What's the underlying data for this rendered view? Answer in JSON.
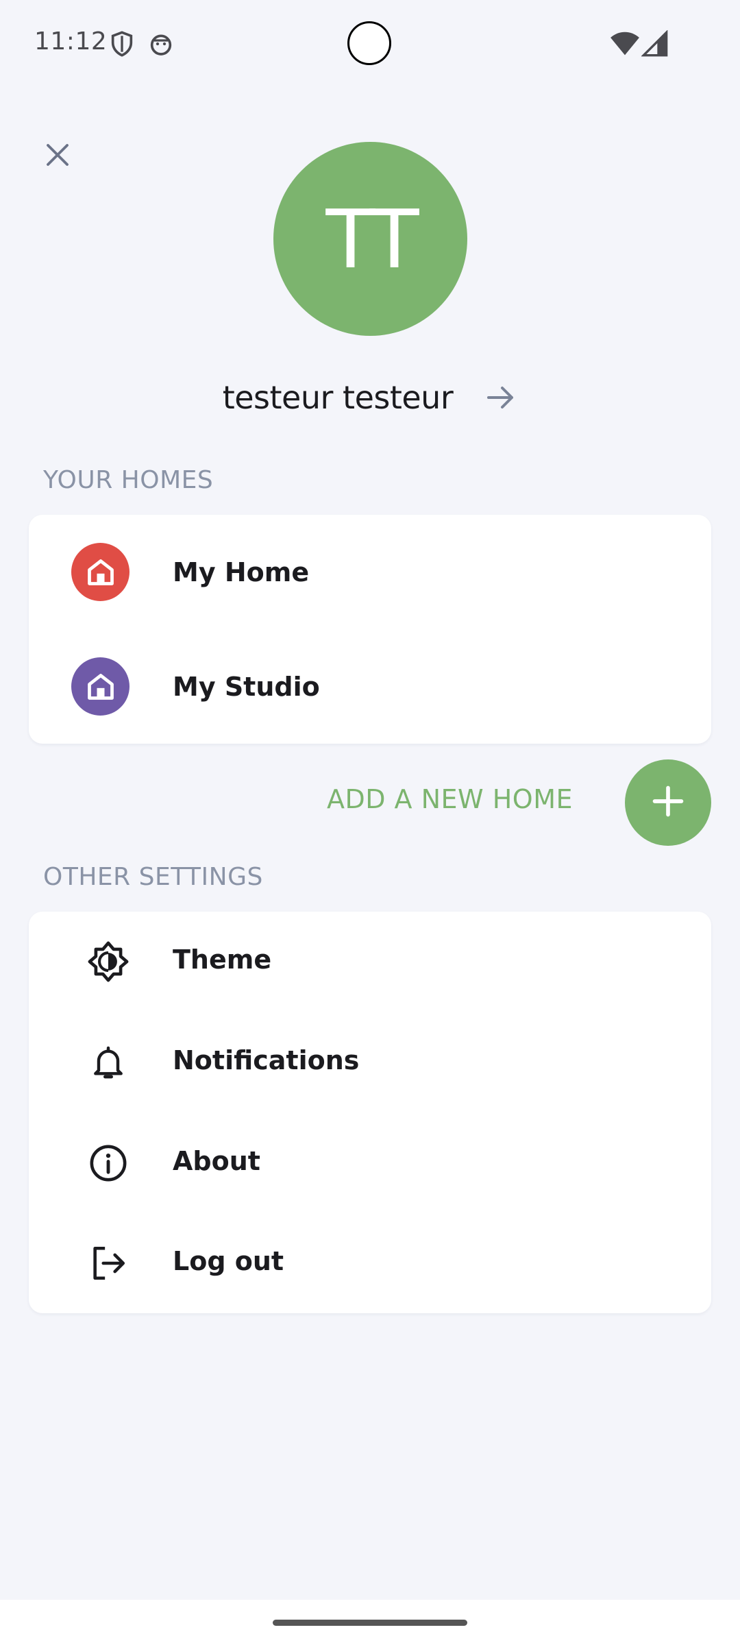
{
  "status_bar": {
    "time": "11:12",
    "icons": [
      "shield-icon",
      "android-robot-icon",
      "wifi-icon",
      "cellular-signal-icon"
    ]
  },
  "header": {
    "close_icon": "close-icon"
  },
  "profile": {
    "initials": "TT",
    "name": "testeur testeur",
    "avatar_color": "#7cb46e",
    "arrow_icon": "arrow-right-icon"
  },
  "homes_section": {
    "title": "YOUR HOMES",
    "items": [
      {
        "label": "My Home",
        "icon": "home-icon",
        "color": "#e04d45"
      },
      {
        "label": "My Studio",
        "icon": "home-icon",
        "color": "#6f5aa8"
      }
    ],
    "add_label": "ADD A NEW HOME",
    "add_icon": "plus-icon"
  },
  "settings_section": {
    "title": "OTHER SETTINGS",
    "items": [
      {
        "label": "Theme",
        "icon": "theme-brightness-icon"
      },
      {
        "label": "Notifications",
        "icon": "bell-icon"
      },
      {
        "label": "About",
        "icon": "info-icon"
      },
      {
        "label": "Log out",
        "icon": "logout-icon"
      }
    ]
  },
  "colors": {
    "background": "#f4f5fa",
    "accent_green": "#7cb46e",
    "section_title": "#8a93a6"
  }
}
